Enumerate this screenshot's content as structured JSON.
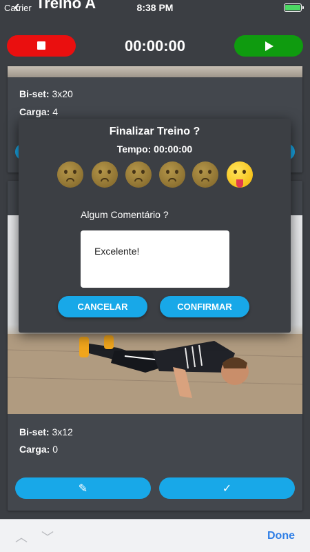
{
  "status_bar": {
    "carrier": "Carrier",
    "time": "8:38 PM",
    "battery_color": "#4cd964"
  },
  "header": {
    "back_icon": "chevron-left-icon",
    "title": "Treino A"
  },
  "timer": {
    "value": "00:00:00",
    "stop_icon": "stop-icon",
    "play_icon": "play-icon",
    "stop_color": "#ea0f0f",
    "play_color": "#0f9b0f"
  },
  "cards": [
    {
      "set_label": "Bi-set:",
      "set_value": "3x20",
      "load_label": "Carga:",
      "load_value": "4"
    },
    {
      "set_label": "Bi-set:",
      "set_value": "3x12",
      "load_label": "Carga:",
      "load_value": "0",
      "edit_icon": "pencil-icon",
      "done_icon": "check-icon"
    }
  ],
  "modal": {
    "title": "Finalizar Treino ?",
    "time_text": "Tempo: 00:00:00",
    "emojis": [
      "sleepy-face-icon",
      "sweating-face-icon",
      "confused-face-icon",
      "anxious-face-icon",
      "tired-face-icon",
      "exhausted-face-icon"
    ],
    "selected_emoji_index": 5,
    "comment_label": "Algum Comentário ?",
    "comment_value": "Excelente!",
    "cancel_label": "CANCELAR",
    "confirm_label": "CONFIRMAR",
    "accent_color": "#18a8e8"
  },
  "keyboard_accessory": {
    "prev_icon": "chevron-up-icon",
    "next_icon": "chevron-down-icon",
    "done_label": "Done",
    "done_color": "#2f7fe6"
  }
}
